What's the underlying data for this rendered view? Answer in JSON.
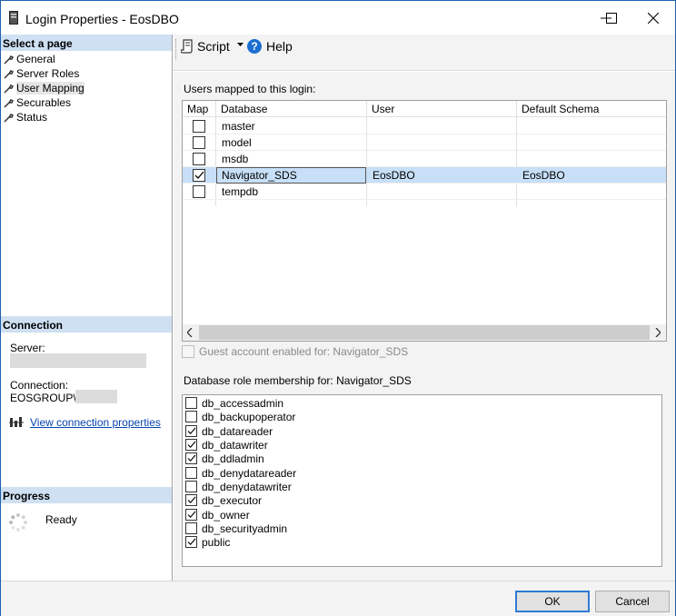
{
  "window": {
    "title": "Login Properties - EosDBO"
  },
  "left_pane": {
    "select_page_header": "Select a page",
    "pages": [
      {
        "label": "General",
        "selected": false
      },
      {
        "label": "Server Roles",
        "selected": false
      },
      {
        "label": "User Mapping",
        "selected": true
      },
      {
        "label": "Securables",
        "selected": false
      },
      {
        "label": "Status",
        "selected": false
      }
    ],
    "connection_header": "Connection",
    "server_label": "Server:",
    "connection_label": "Connection:",
    "connection_value": "EOSGROUP\\",
    "view_connection_link": "View connection properties",
    "progress_header": "Progress",
    "progress_status": "Ready"
  },
  "toolbar": {
    "script_label": "Script",
    "help_label": "Help"
  },
  "main": {
    "users_mapped_label": "Users mapped to this login:",
    "columns": [
      "Map",
      "Database",
      "User",
      "Default Schema"
    ],
    "rows": [
      {
        "map": false,
        "database": "master",
        "user": "",
        "schema": "",
        "selected": false
      },
      {
        "map": false,
        "database": "model",
        "user": "",
        "schema": "",
        "selected": false
      },
      {
        "map": false,
        "database": "msdb",
        "user": "",
        "schema": "",
        "selected": false
      },
      {
        "map": true,
        "database": "Navigator_SDS",
        "user": "EosDBO",
        "schema": "EosDBO",
        "selected": true
      },
      {
        "map": false,
        "database": "tempdb",
        "user": "",
        "schema": "",
        "selected": false
      }
    ],
    "guest_label": "Guest account enabled for: Navigator_SDS",
    "guest_checked": false,
    "role_membership_label": "Database role membership for: Navigator_SDS",
    "roles": [
      {
        "name": "db_accessadmin",
        "checked": false
      },
      {
        "name": "db_backupoperator",
        "checked": false
      },
      {
        "name": "db_datareader",
        "checked": true
      },
      {
        "name": "db_datawriter",
        "checked": true
      },
      {
        "name": "db_ddladmin",
        "checked": true
      },
      {
        "name": "db_denydatareader",
        "checked": false
      },
      {
        "name": "db_denydatawriter",
        "checked": false
      },
      {
        "name": "db_executor",
        "checked": true
      },
      {
        "name": "db_owner",
        "checked": true
      },
      {
        "name": "db_securityadmin",
        "checked": false
      },
      {
        "name": "public",
        "checked": true
      }
    ]
  },
  "footer": {
    "ok_label": "OK",
    "cancel_label": "Cancel"
  },
  "colors": {
    "section_header": "#cfe0f3",
    "selected_row": "#c7dff7",
    "link": "#0645ad",
    "primary_border": "#2f7ad4"
  }
}
